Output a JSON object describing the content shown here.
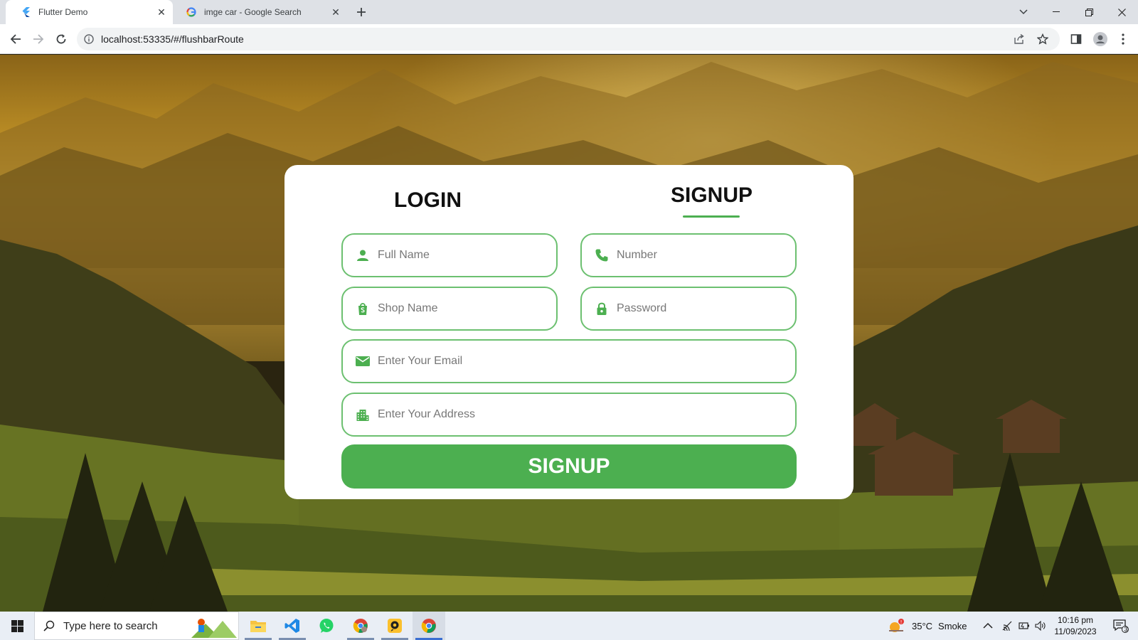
{
  "browser": {
    "tabs": [
      {
        "title": "Flutter Demo",
        "active": true,
        "icon": "flutter-icon"
      },
      {
        "title": "imge car - Google Search",
        "active": false,
        "icon": "google-icon"
      }
    ],
    "url": "localhost:53335/#/flushbarRoute"
  },
  "form": {
    "tab_login": "LOGIN",
    "tab_signup": "SIGNUP",
    "active_tab": "SIGNUP",
    "accent_color": "#4caf50",
    "fields": {
      "full_name": {
        "placeholder": "Full Name",
        "icon": "person-icon"
      },
      "number": {
        "placeholder": "Number",
        "icon": "phone-icon"
      },
      "shop_name": {
        "placeholder": "Shop Name",
        "icon": "shopping-bag-icon"
      },
      "password": {
        "placeholder": "Password",
        "icon": "lock-icon"
      },
      "email": {
        "placeholder": "Enter Your Email",
        "icon": "mail-icon"
      },
      "address": {
        "placeholder": "Enter Your Address",
        "icon": "apartment-icon"
      }
    },
    "submit_label": "SIGNUP"
  },
  "taskbar": {
    "search_placeholder": "Type here to search",
    "weather": {
      "temp": "35°C",
      "condition": "Smoke"
    },
    "clock": {
      "time": "10:16 pm",
      "date": "11/09/2023"
    },
    "notification_count": "3"
  }
}
